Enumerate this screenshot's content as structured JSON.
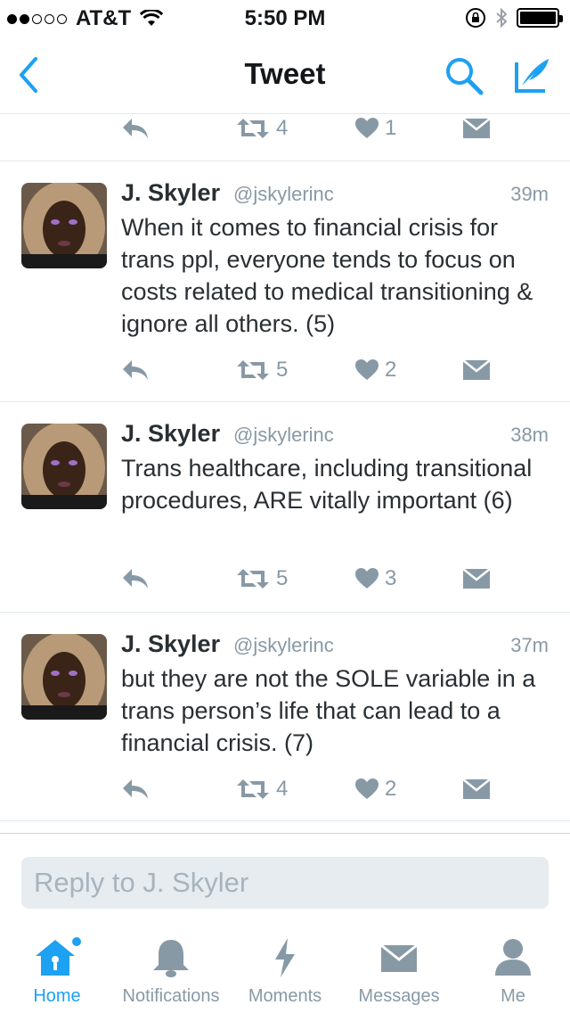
{
  "status_bar": {
    "carrier": "AT&T",
    "time": "5:50 PM",
    "battery_level": 1.0
  },
  "nav": {
    "title": "Tweet",
    "accent": "#1da1f2"
  },
  "partial_tweet": {
    "retweets": "4",
    "likes": "1"
  },
  "tweets": [
    {
      "name": "J. Skyler",
      "handle": "@jskylerinc",
      "time": "39m",
      "text": "When it comes to financial crisis for trans ppl, everyone tends to focus on costs related to medical transitioning & ignore all others. (5)",
      "retweets": "5",
      "likes": "2"
    },
    {
      "name": "J. Skyler",
      "handle": "@jskylerinc",
      "time": "38m",
      "text": "Trans healthcare, including transitional procedures, ARE vitally important (6)",
      "retweets": "5",
      "likes": "3"
    },
    {
      "name": "J. Skyler",
      "handle": "@jskylerinc",
      "time": "37m",
      "text": "but they are not the SOLE variable in a trans person’s life that can lead to a financial crisis. (7)",
      "retweets": "4",
      "likes": "2"
    }
  ],
  "reply": {
    "placeholder": "Reply to J. Skyler"
  },
  "tabs": [
    {
      "label": "Home",
      "icon": "home-icon",
      "active": true
    },
    {
      "label": "Notifications",
      "icon": "bell-icon",
      "active": false
    },
    {
      "label": "Moments",
      "icon": "lightning-icon",
      "active": false
    },
    {
      "label": "Messages",
      "icon": "envelope-icon",
      "active": false
    },
    {
      "label": "Me",
      "icon": "person-icon",
      "active": false
    }
  ]
}
